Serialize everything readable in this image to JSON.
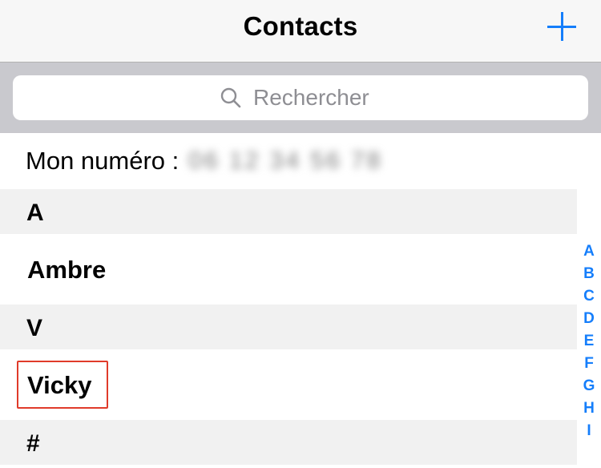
{
  "colors": {
    "accent": "#157efb",
    "highlight": "#e03b2a"
  },
  "navbar": {
    "title": "Contacts",
    "add_icon": "plus-icon"
  },
  "search": {
    "placeholder": "Rechercher",
    "value": "",
    "icon": "search-icon"
  },
  "my_number": {
    "label": "Mon numéro :",
    "value": "06 12 34 56 78"
  },
  "sections": [
    {
      "letter": "A",
      "contacts": [
        "Ambre"
      ]
    },
    {
      "letter": "V",
      "contacts": [
        "Vicky"
      ]
    },
    {
      "letter": "#",
      "contacts": []
    }
  ],
  "index": [
    "A",
    "B",
    "C",
    "D",
    "E",
    "F",
    "G",
    "H",
    "I"
  ]
}
